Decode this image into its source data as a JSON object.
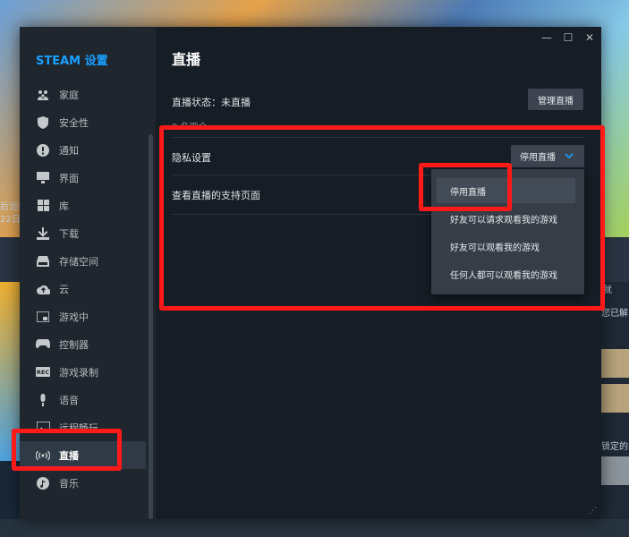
{
  "background": {
    "left_texts": [
      "后运行",
      "22日"
    ],
    "right_texts": [
      "就",
      "您已解",
      "锁定的"
    ]
  },
  "window": {
    "minimize": "—",
    "maximize": "☐",
    "close": "✕"
  },
  "sidebar": {
    "title": "STEAM 设置",
    "items": [
      {
        "label": "家庭",
        "icon": "family-icon"
      },
      {
        "label": "安全性",
        "icon": "shield-icon"
      },
      {
        "label": "通知",
        "icon": "alert-icon"
      },
      {
        "label": "界面",
        "icon": "monitor-icon"
      },
      {
        "label": "库",
        "icon": "grid-icon"
      },
      {
        "label": "下载",
        "icon": "download-icon"
      },
      {
        "label": "存储空间",
        "icon": "storage-icon"
      },
      {
        "label": "云",
        "icon": "cloud-icon"
      },
      {
        "label": "游戏中",
        "icon": "ingame-icon"
      },
      {
        "label": "控制器",
        "icon": "controller-icon"
      },
      {
        "label": "游戏录制",
        "icon": "rec-icon"
      },
      {
        "label": "语音",
        "icon": "mic-icon"
      },
      {
        "label": "远程畅玩",
        "icon": "remote-play-icon"
      },
      {
        "label": "直播",
        "icon": "broadcast-icon"
      },
      {
        "label": "音乐",
        "icon": "music-icon"
      }
    ],
    "active_index": 13
  },
  "main": {
    "title": "直播",
    "status": "直播状态：未直播",
    "manage_button": "管理直播",
    "viewers": "0 名观众",
    "privacy_label": "隐私设置",
    "privacy_value": "停用直播",
    "support_link": "查看直播的支持页面",
    "dropdown_options": [
      "停用直播",
      "好友可以请求观看我的游戏",
      "好友可以观看我的游戏",
      "任何人都可以观看我的游戏"
    ]
  }
}
